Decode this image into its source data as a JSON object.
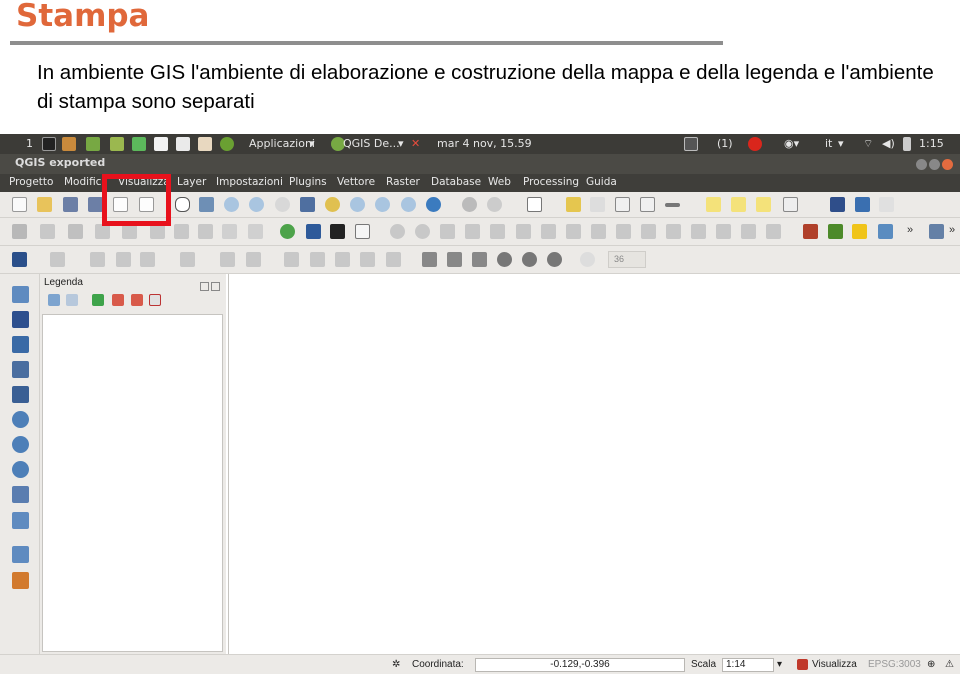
{
  "slide": {
    "title": "Stampa",
    "body": "In ambiente GIS l'ambiente di elaborazione e costruzione della mappa e della legenda e l'ambiente di stampa sono separati"
  },
  "system_bar": {
    "workspace": "1",
    "applications": "Applicazioni",
    "active_task": "QGIS De...",
    "datetime": "mar  4 nov, 15.59",
    "mail_count": "(1)",
    "keyboard": "it",
    "time": "1:15"
  },
  "window": {
    "title": "QGIS exported"
  },
  "menu": {
    "items": [
      "Progetto",
      "Modifica",
      "Visualizza",
      "Layer",
      "Impostazioni",
      "Plugins",
      "Vettore",
      "Raster",
      "Database",
      "Web",
      "Processing",
      "Guida"
    ]
  },
  "toolbar": {
    "spin_value": "36"
  },
  "legend": {
    "title": "Legenda"
  },
  "status": {
    "coord_label": "Coordinata:",
    "coord_value": "-0.129,-0.396",
    "scale_label": "Scala",
    "scale_value": "1:14",
    "render_label": "Visualizza",
    "crs": "EPSG:3003"
  },
  "colors": {
    "accent_title": "#e0683a",
    "highlight": "#e8111c",
    "menubar": "#3f3e3a"
  }
}
